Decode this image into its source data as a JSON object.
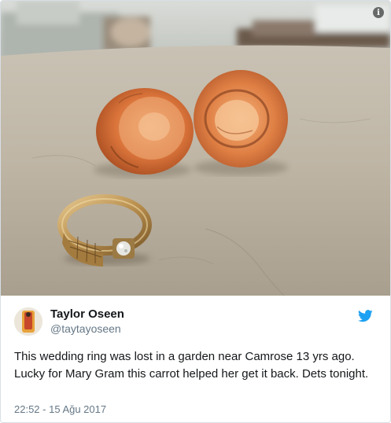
{
  "tweet": {
    "display_name": "Taylor Oseen",
    "handle": "@taytayoseen",
    "text": "This wedding ring was lost in a garden near Camrose 13 yrs ago. Lucky for Mary Gram this carrot helped her get it back. Dets tonight.",
    "timestamp": "22:52 - 15 Ağu 2017"
  },
  "icons": {
    "info": "info-icon",
    "brand": "twitter-bird-icon"
  },
  "colors": {
    "twitter_blue": "#1da1f2",
    "text": "#14171a",
    "muted": "#657786",
    "border": "#d8dfe5"
  }
}
